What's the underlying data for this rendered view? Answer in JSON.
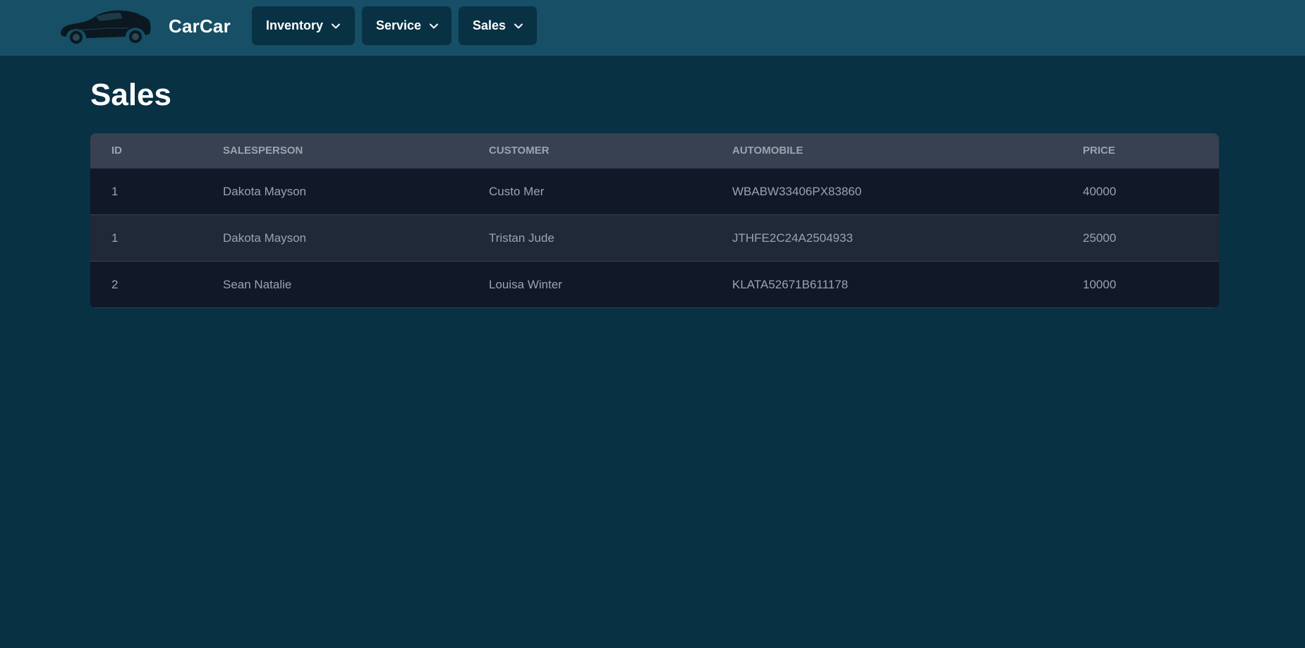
{
  "nav": {
    "brand": "CarCar",
    "menus": [
      {
        "label": "Inventory"
      },
      {
        "label": "Service"
      },
      {
        "label": "Sales"
      }
    ]
  },
  "page": {
    "title": "Sales"
  },
  "table": {
    "headers": [
      "ID",
      "SALESPERSON",
      "CUSTOMER",
      "AUTOMOBILE",
      "PRICE"
    ],
    "rows": [
      [
        "1",
        "Dakota Mayson",
        "Custo Mer",
        "WBABW33406PX83860",
        "40000"
      ],
      [
        "1",
        "Dakota Mayson",
        "Tristan Jude",
        "JTHFE2C24A2504933",
        "25000"
      ],
      [
        "2",
        "Sean Natalie",
        "Louisa Winter",
        "KLATA52671B611178",
        "10000"
      ]
    ]
  },
  "icons": {
    "logo": "car-silhouette-icon",
    "dropdown": "chevron-down-icon"
  },
  "colors": {
    "navbar_bg": "#164f66",
    "page_bg": "#083144",
    "table_header_bg": "#374151",
    "row_odd_bg": "#111827",
    "row_even_bg": "#1f2937",
    "text_muted": "#9ca3af"
  }
}
